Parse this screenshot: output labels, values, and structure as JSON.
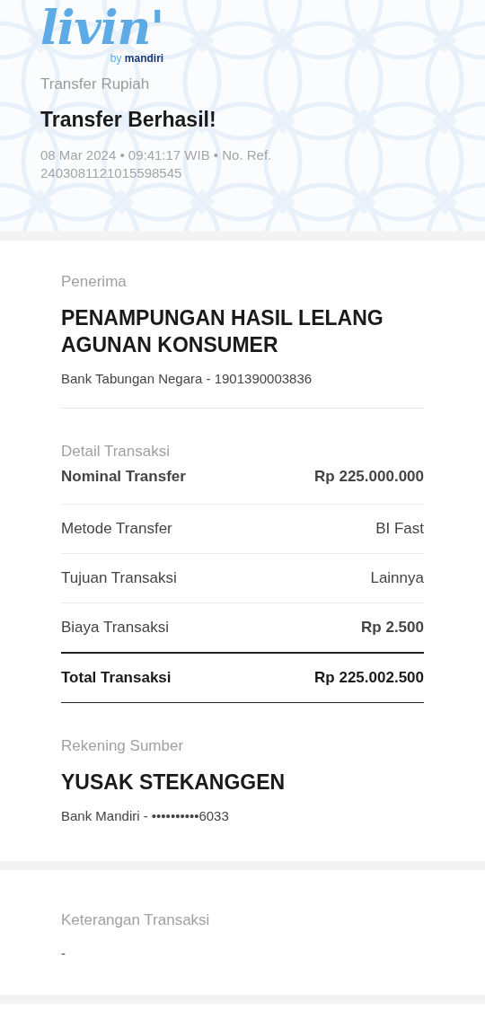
{
  "logo": {
    "wordmark": "livin'",
    "byline_prefix": "by",
    "byline_brand": "mandiri"
  },
  "header": {
    "category": "Transfer Rupiah",
    "title": "Transfer Berhasil!",
    "meta": "08 Mar 2024 • 09:41:17 WIB • No. Ref. 2403081121015598545"
  },
  "recipient": {
    "label": "Penerima",
    "name": "PENAMPUNGAN HASIL LELANG AGUNAN KONSUMER",
    "account": "Bank Tabungan Negara - 1901390003836"
  },
  "details": {
    "label": "Detail Transaksi",
    "rows": [
      {
        "kind": "bold",
        "label": "Nominal Transfer",
        "value": "Rp 225.000.000"
      },
      {
        "kind": "normal",
        "label": "Metode Transfer",
        "value": "BI Fast"
      },
      {
        "kind": "normal",
        "label": "Tujuan Transaksi",
        "value": "Lainnya"
      },
      {
        "kind": "fee",
        "label": "Biaya Transaksi",
        "value": "Rp 2.500"
      },
      {
        "kind": "total",
        "label": "Total Transaksi",
        "value": "Rp 225.002.500"
      }
    ]
  },
  "source": {
    "label": "Rekening Sumber",
    "name": "YUSAK STEKANGGEN",
    "account": "Bank Mandiri - ••••••••••6033"
  },
  "note": {
    "label": "Keterangan Transaksi",
    "value": "-"
  }
}
